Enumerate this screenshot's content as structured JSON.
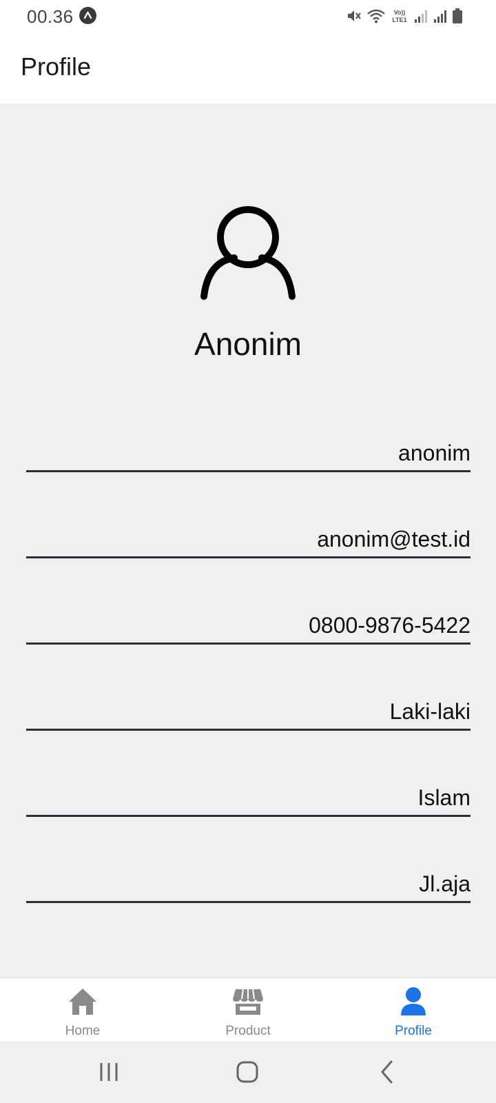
{
  "status_bar": {
    "time": "00.36",
    "network_label": "Vo))\nLTE1"
  },
  "header": {
    "title": "Profile"
  },
  "profile": {
    "name": "Anonim",
    "avatar_icon": "user-outline-icon",
    "fields": [
      {
        "key": "username",
        "value": "anonim"
      },
      {
        "key": "email",
        "value": "anonim@test.id"
      },
      {
        "key": "phone",
        "value": "0800-9876-5422"
      },
      {
        "key": "gender",
        "value": "Laki-laki"
      },
      {
        "key": "religion",
        "value": "Islam"
      },
      {
        "key": "address",
        "value": "Jl.aja"
      }
    ]
  },
  "bottom_nav": {
    "items": [
      {
        "label": "Home",
        "icon": "home-icon",
        "active": false
      },
      {
        "label": "Product",
        "icon": "store-icon",
        "active": false
      },
      {
        "label": "Profile",
        "icon": "user-icon",
        "active": true
      }
    ]
  },
  "colors": {
    "accent": "#1a73e8",
    "inactive": "#8a8a8a",
    "background": "#f0f0f0",
    "underline": "#2b3036"
  }
}
